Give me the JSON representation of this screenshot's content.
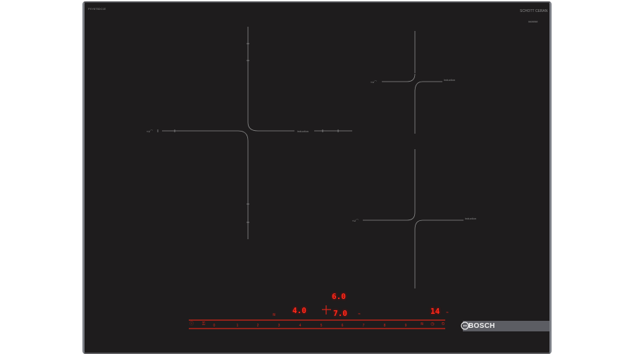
{
  "hob": {
    "model": "PXY875DC1E",
    "glass_brand": "SCHOTT CERAN",
    "glass_code": "######",
    "brand": "BOSCH",
    "zone_label_left": "induction",
    "zone_label_right": "induction",
    "zone_label_rt": "induction",
    "zone_label_rb": "induction",
    "zone_icon_text": "≈⊍⌒"
  },
  "displays": {
    "top": "6.0",
    "left": "4.0",
    "center": "7.0",
    "right": "14",
    "top_sub": "≈",
    "left_sub": "≋",
    "right_sub": "≈"
  },
  "control_bar": {
    "power": "ⓘ",
    "child_lock": "⚿",
    "scale": [
      "0",
      "1",
      "2",
      "3",
      "4",
      "5",
      "6",
      "7",
      "8",
      "9"
    ],
    "boost": "≋",
    "timer": "◷",
    "clock": "⏲"
  },
  "colors": {
    "glass": "#1e1c1d",
    "frame": "#7d8087",
    "display_red": "#ff2a1a",
    "print_line": "#8e8e8e"
  }
}
